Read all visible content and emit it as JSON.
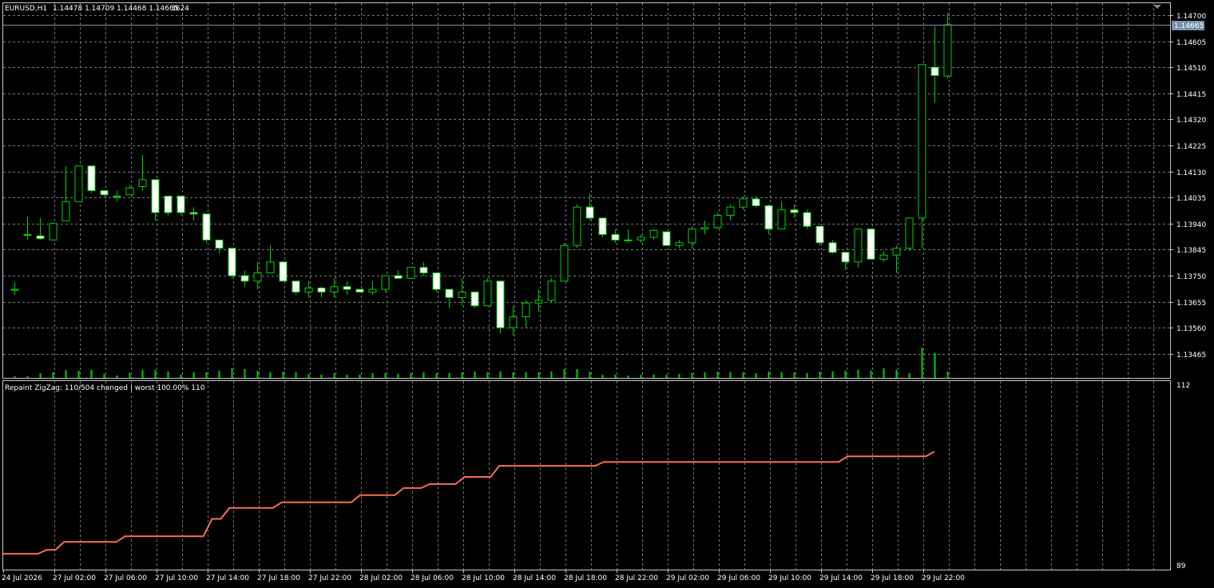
{
  "header": {
    "symbol": "EURUSD,H1",
    "ohlc": "1.14478 1.14709 1.14468 1.14665",
    "ticks": "3624"
  },
  "price_scale": {
    "labels": [
      "1.14700",
      "1.14605",
      "1.14510",
      "1.14415",
      "1.14320",
      "1.14225",
      "1.14130",
      "1.14035",
      "1.13940",
      "1.13845",
      "1.13750",
      "1.13655",
      "1.13560",
      "1.13465"
    ],
    "current_price": "1.14665"
  },
  "indicator": {
    "title": "Repaint ZigZag: 110/504 changed | worst 100.00% 110",
    "scale_top": "112",
    "scale_bottom": "89"
  },
  "time_axis": [
    "24 Jul 2026",
    "27 Jul 02:00",
    "27 Jul 06:00",
    "27 Jul 10:00",
    "27 Jul 14:00",
    "27 Jul 18:00",
    "27 Jul 22:00",
    "28 Jul 02:00",
    "28 Jul 06:00",
    "28 Jul 10:00",
    "28 Jul 14:00",
    "28 Jul 18:00",
    "28 Jul 22:00",
    "29 Jul 02:00",
    "29 Jul 06:00",
    "29 Jul 10:00",
    "29 Jul 14:00",
    "29 Jul 18:00",
    "29 Jul 22:00"
  ],
  "colors": {
    "background": "#000000",
    "grid": "#787878",
    "candle_outline": "#00d200",
    "bull_body": "#000000",
    "bear_body": "#ffffff",
    "volume": "#00d200",
    "indicator_line": "#fa6e50",
    "price_line": "#7890a8",
    "frame": "#c8c8c8"
  },
  "chart_data": [
    {
      "type": "candlestick",
      "title": "EURUSD,H1",
      "ylim": [
        1.1341,
        1.1475
      ],
      "columns": [
        "open",
        "high",
        "low",
        "close"
      ],
      "candles": [
        [
          1.137,
          1.13725,
          1.1368,
          1.137
        ],
        [
          1.139,
          1.13965,
          1.1388,
          1.139
        ],
        [
          1.13895,
          1.1396,
          1.1388,
          1.13885
        ],
        [
          1.1388,
          1.13945,
          1.1388,
          1.1394
        ],
        [
          1.1395,
          1.1415,
          1.1395,
          1.1402
        ],
        [
          1.1402,
          1.1415,
          1.1402,
          1.1415
        ],
        [
          1.1415,
          1.1415,
          1.1405,
          1.1406
        ],
        [
          1.1406,
          1.1406,
          1.1404,
          1.14045
        ],
        [
          1.1404,
          1.1406,
          1.1402,
          1.1404
        ],
        [
          1.14045,
          1.1408,
          1.14045,
          1.1407
        ],
        [
          1.14075,
          1.1419,
          1.1406,
          1.141
        ],
        [
          1.141,
          1.141,
          1.1395,
          1.1398
        ],
        [
          1.1404,
          1.1404,
          1.1397,
          1.1398
        ],
        [
          1.1404,
          1.1404,
          1.1397,
          1.1398
        ],
        [
          1.1398,
          1.14,
          1.1395,
          1.13975
        ],
        [
          1.13975,
          1.13975,
          1.1387,
          1.1388
        ],
        [
          1.1388,
          1.1388,
          1.1383,
          1.1385
        ],
        [
          1.1385,
          1.1385,
          1.1374,
          1.1375
        ],
        [
          1.1375,
          1.1377,
          1.1371,
          1.1373
        ],
        [
          1.1373,
          1.138,
          1.137,
          1.1376
        ],
        [
          1.1376,
          1.1386,
          1.1376,
          1.138
        ],
        [
          1.138,
          1.138,
          1.1373,
          1.1373
        ],
        [
          1.1373,
          1.1373,
          1.1368,
          1.1369
        ],
        [
          1.1369,
          1.1373,
          1.1367,
          1.13705
        ],
        [
          1.13705,
          1.1371,
          1.1367,
          1.1369
        ],
        [
          1.1369,
          1.1374,
          1.1367,
          1.1371
        ],
        [
          1.1371,
          1.1373,
          1.1368,
          1.137
        ],
        [
          1.137,
          1.137,
          1.1369,
          1.1369
        ],
        [
          1.1369,
          1.1373,
          1.1368,
          1.137
        ],
        [
          1.137,
          1.1375,
          1.1369,
          1.1375
        ],
        [
          1.1375,
          1.1377,
          1.1374,
          1.1374
        ],
        [
          1.1374,
          1.1378,
          1.1374,
          1.1378
        ],
        [
          1.1378,
          1.138,
          1.1375,
          1.1376
        ],
        [
          1.1376,
          1.1376,
          1.1369,
          1.137
        ],
        [
          1.137,
          1.137,
          1.1363,
          1.1367
        ],
        [
          1.1367,
          1.1374,
          1.1364,
          1.1369
        ],
        [
          1.1369,
          1.1369,
          1.1363,
          1.1364
        ],
        [
          1.1364,
          1.1374,
          1.1364,
          1.1373
        ],
        [
          1.1373,
          1.1373,
          1.1354,
          1.1356
        ],
        [
          1.1356,
          1.1364,
          1.1353,
          1.136
        ],
        [
          1.136,
          1.1366,
          1.1356,
          1.1365
        ],
        [
          1.1365,
          1.137,
          1.1362,
          1.1366
        ],
        [
          1.1366,
          1.1374,
          1.1365,
          1.1373
        ],
        [
          1.1373,
          1.1387,
          1.1373,
          1.1386
        ],
        [
          1.1386,
          1.1401,
          1.1385,
          1.14
        ],
        [
          1.14,
          1.1405,
          1.1395,
          1.1396
        ],
        [
          1.1396,
          1.1396,
          1.1389,
          1.139
        ],
        [
          1.139,
          1.1392,
          1.1387,
          1.1388
        ],
        [
          1.1388,
          1.1392,
          1.1387,
          1.1388
        ],
        [
          1.1388,
          1.139,
          1.1387,
          1.1389
        ],
        [
          1.1389,
          1.1392,
          1.1388,
          1.13915
        ],
        [
          1.1391,
          1.1391,
          1.1386,
          1.1386
        ],
        [
          1.1386,
          1.1388,
          1.1385,
          1.1387
        ],
        [
          1.1387,
          1.1393,
          1.1385,
          1.1392
        ],
        [
          1.1392,
          1.1395,
          1.139,
          1.13925
        ],
        [
          1.13925,
          1.1398,
          1.1392,
          1.1397
        ],
        [
          1.1397,
          1.1401,
          1.1395,
          1.14
        ],
        [
          1.14,
          1.1404,
          1.1399,
          1.1403
        ],
        [
          1.1403,
          1.1404,
          1.14,
          1.14005
        ],
        [
          1.14005,
          1.1401,
          1.139,
          1.1392
        ],
        [
          1.1392,
          1.1402,
          1.1392,
          1.1399
        ],
        [
          1.1399,
          1.1401,
          1.1396,
          1.1398
        ],
        [
          1.1398,
          1.1399,
          1.1392,
          1.1393
        ],
        [
          1.1393,
          1.1393,
          1.1386,
          1.1387
        ],
        [
          1.1387,
          1.1388,
          1.1383,
          1.13835
        ],
        [
          1.13835,
          1.13835,
          1.1377,
          1.138
        ],
        [
          1.138,
          1.1392,
          1.1378,
          1.1392
        ],
        [
          1.1392,
          1.1392,
          1.1381,
          1.1381
        ],
        [
          1.1381,
          1.1384,
          1.138,
          1.13825
        ],
        [
          1.13825,
          1.1386,
          1.1376,
          1.1385
        ],
        [
          1.1385,
          1.1396,
          1.1384,
          1.1396
        ],
        [
          1.1396,
          1.1452,
          1.1385,
          1.1452
        ],
        [
          1.1451,
          1.1466,
          1.1438,
          1.1448
        ],
        [
          1.14478,
          1.14709,
          1.14468,
          1.14665
        ]
      ],
      "volume": [
        2,
        2,
        6,
        7,
        10,
        9,
        10,
        5,
        3,
        6,
        10,
        10,
        8,
        4,
        7,
        7,
        9,
        12,
        11,
        9,
        7,
        8,
        7,
        5,
        4,
        6,
        4,
        4,
        6,
        6,
        5,
        6,
        7,
        6,
        6,
        7,
        8,
        7,
        8,
        7,
        7,
        7,
        8,
        11,
        11,
        8,
        4,
        4,
        3,
        4,
        4,
        4,
        5,
        6,
        7,
        8,
        7,
        7,
        6,
        8,
        7,
        7,
        6,
        8,
        8,
        9,
        10,
        9,
        12,
        10,
        6,
        38,
        31,
        8
      ]
    },
    {
      "type": "line",
      "title": "Repaint ZigZag: 110/504 changed | worst 100.00% 110",
      "ylim": [
        89,
        112
      ],
      "values": [
        90.7,
        90.7,
        90.7,
        90.7,
        90.7,
        91.2,
        91.2,
        92.2,
        92.2,
        92.2,
        92.2,
        92.2,
        92.2,
        92.2,
        92.9,
        92.9,
        92.9,
        92.9,
        92.9,
        92.9,
        92.9,
        92.9,
        92.9,
        92.9,
        95.1,
        95.1,
        96.5,
        96.5,
        96.5,
        96.5,
        96.5,
        96.5,
        97.2,
        97.2,
        97.2,
        97.2,
        97.2,
        97.2,
        97.2,
        97.2,
        97.2,
        98.1,
        98.1,
        98.1,
        98.1,
        98.1,
        99.0,
        99.0,
        99.0,
        99.5,
        99.5,
        99.5,
        99.5,
        100.4,
        100.4,
        100.4,
        100.4,
        101.8,
        101.8,
        101.8,
        101.8,
        101.8,
        101.8,
        101.8,
        101.8,
        101.8,
        101.8,
        101.8,
        101.8,
        102.3,
        102.3,
        102.3,
        102.3,
        102.3,
        102.3,
        102.3,
        102.3,
        102.3,
        102.3,
        102.3,
        102.3,
        102.3,
        102.3,
        102.3,
        102.3,
        102.3,
        102.3,
        102.3,
        102.3,
        102.3,
        102.3,
        102.3,
        102.3,
        102.3,
        102.3,
        102.3,
        102.3,
        103.0,
        103.0,
        103.0,
        103.0,
        103.0,
        103.0,
        103.0,
        103.0,
        103.0,
        103.0,
        103.6
      ]
    }
  ]
}
